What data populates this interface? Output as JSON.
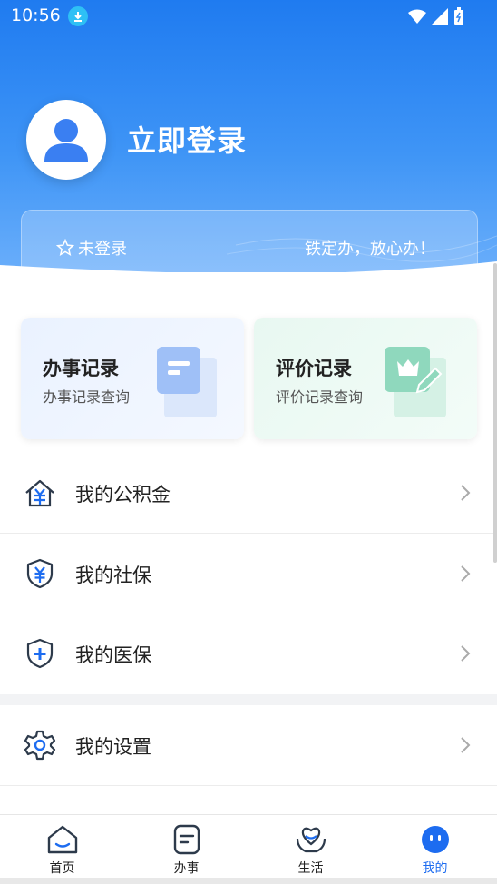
{
  "status": {
    "time": "10:56"
  },
  "header": {
    "login_text": "立即登录",
    "not_logged": "未登录",
    "slogan": "铁定办，放心办！"
  },
  "quick": [
    {
      "title": "办事记录",
      "sub": "办事记录查询"
    },
    {
      "title": "评价记录",
      "sub": "评价记录查询"
    }
  ],
  "menu": [
    {
      "label": "我的公积金",
      "icon": "housing-fund-icon"
    },
    {
      "label": "我的社保",
      "icon": "social-security-shield-icon"
    },
    {
      "label": "我的医保",
      "icon": "medical-insurance-shield-icon"
    },
    {
      "label": "我的设置",
      "icon": "settings-gear-icon"
    }
  ],
  "tabs": [
    {
      "label": "首页",
      "icon": "home-icon"
    },
    {
      "label": "办事",
      "icon": "document-icon"
    },
    {
      "label": "生活",
      "icon": "heart-hands-icon"
    },
    {
      "label": "我的",
      "icon": "profile-face-icon",
      "active": true
    }
  ],
  "colors": {
    "primary": "#1d6cf0",
    "header_top": "#1f7bf0",
    "dark_icon": "#2d3a4b"
  }
}
